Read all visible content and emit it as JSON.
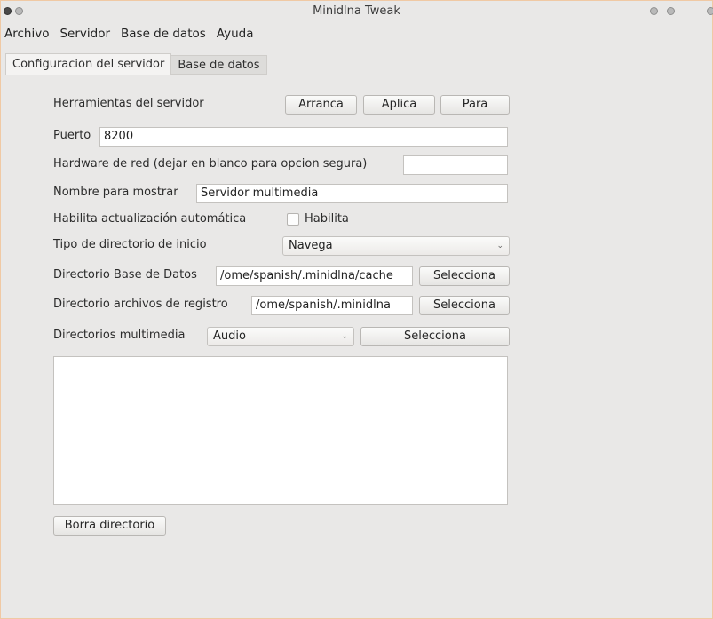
{
  "window": {
    "title": "Minidlna Tweak"
  },
  "menu": [
    "Archivo",
    "Servidor",
    "Base de datos",
    "Ayuda"
  ],
  "tabs": [
    "Configuracion del servidor",
    "Base de datos"
  ],
  "tools": {
    "label": "Herramientas del servidor",
    "start": "Arranca",
    "apply": "Aplica",
    "stop": "Para"
  },
  "port": {
    "label": "Puerto",
    "value": "8200"
  },
  "hardware": {
    "label": "Hardware de red (dejar en blanco para opcion segura)",
    "value": ""
  },
  "display_name": {
    "label": "Nombre para mostrar",
    "value": "Servidor multimedia"
  },
  "autoupdate": {
    "label": "Habilita actualización automática",
    "checkbox_label": "Habilita",
    "checked": false
  },
  "start_dir": {
    "label": "Tipo de directorio de inicio",
    "value": "Navega"
  },
  "db_dir": {
    "label": "Directorio Base de Datos",
    "value": "ome/spanish/.minidlna/cache/",
    "button": "Selecciona"
  },
  "log_dir": {
    "label": "Directorio archivos de registro",
    "value": "ome/spanish/.minidlna/",
    "button": "Selecciona"
  },
  "media_dirs": {
    "label": "Directorios multimedia",
    "type": "Audio",
    "button": "Selecciona",
    "items": []
  },
  "delete_dir_button": "Borra directorio"
}
